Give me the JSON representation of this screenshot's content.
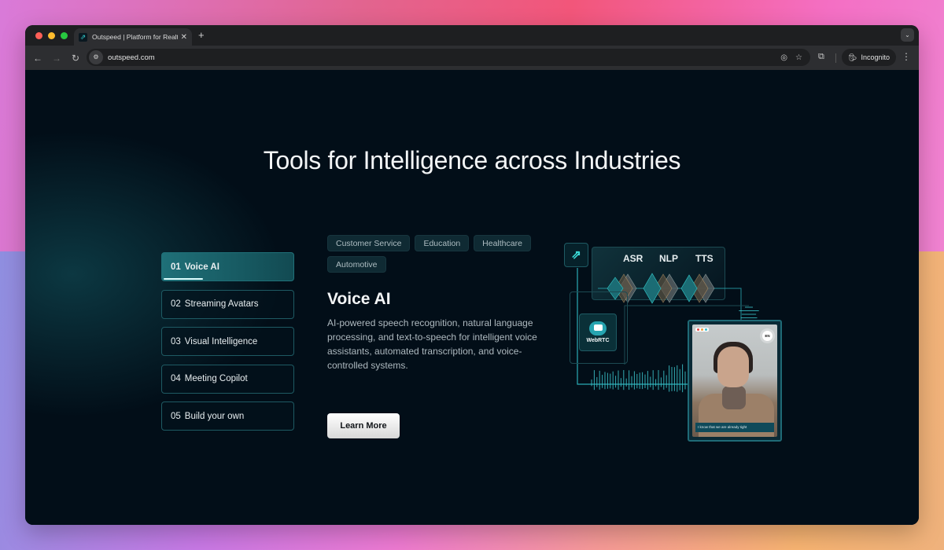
{
  "browser": {
    "tab": {
      "title": "Outspeed | Platform for Realti",
      "favicon": "outspeed-logo-icon"
    },
    "url": "outspeed.com",
    "incognito_label": "Incognito"
  },
  "page": {
    "title": "Tools for Intelligence across Industries",
    "menu": [
      {
        "num": "01",
        "label": "Voice AI",
        "active": true
      },
      {
        "num": "02",
        "label": "Streaming Avatars"
      },
      {
        "num": "03",
        "label": "Visual Intelligence"
      },
      {
        "num": "04",
        "label": "Meeting Copilot"
      },
      {
        "num": "05",
        "label": "Build your own"
      }
    ],
    "active_progress": 0.3,
    "chips": [
      "Customer Service",
      "Education",
      "Healthcare",
      "Automotive"
    ],
    "section_title": "Voice AI",
    "section_desc": "AI-powered speech recognition, natural language processing, and text-to-speech for intelligent voice assistants, automated transcription, and voice-controlled systems.",
    "cta_label": "Learn More",
    "illustration": {
      "stages": [
        "ASR",
        "NLP",
        "TTS"
      ],
      "webrtc_label": "WebRTC",
      "lang_badge": "EN",
      "caption": "I know that we are already tight"
    }
  }
}
